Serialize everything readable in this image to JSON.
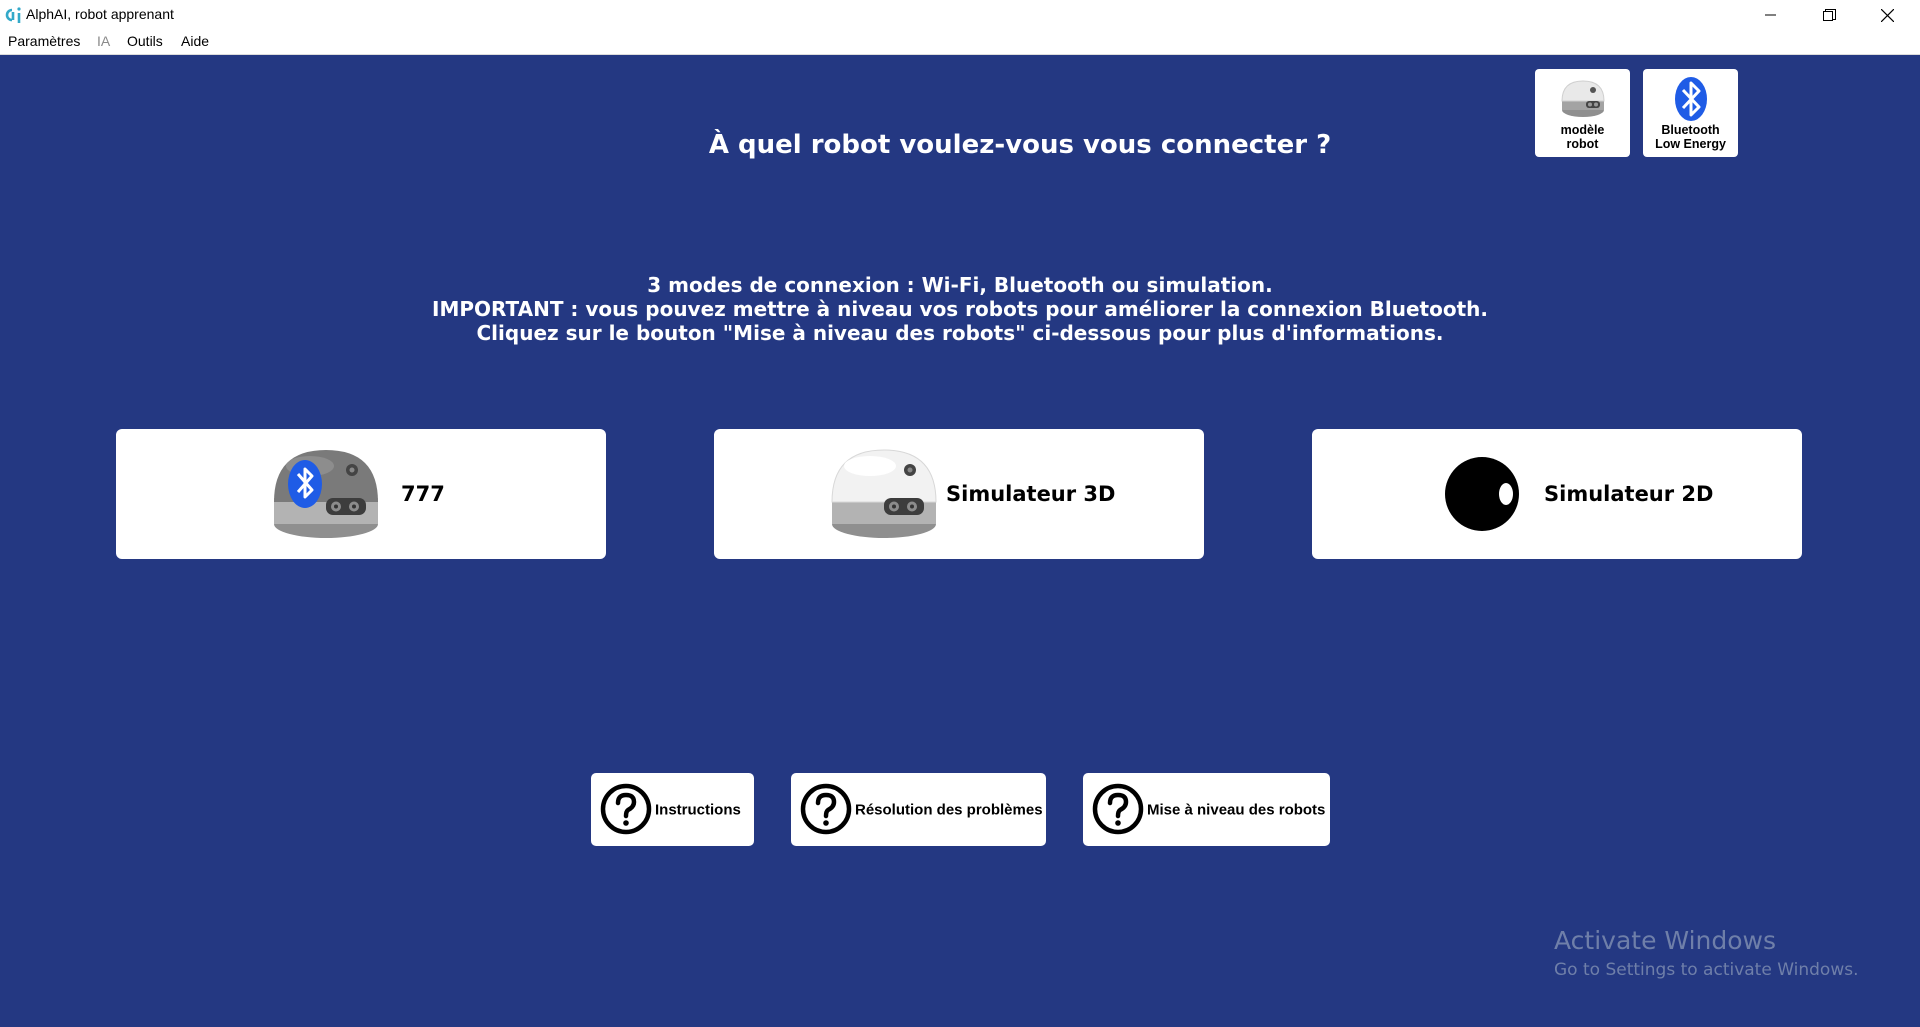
{
  "window": {
    "title": "AlphAI, robot apprenant",
    "logo_color": "#33a9c9"
  },
  "menu": {
    "items": [
      {
        "label": "Paramètres",
        "enabled": true
      },
      {
        "label": "IA",
        "enabled": false
      },
      {
        "label": "Outils",
        "enabled": true
      },
      {
        "label": "Aide",
        "enabled": true
      }
    ]
  },
  "top_buttons": {
    "robot_model_label": "modèle\nrobot",
    "bluetooth_label": "Bluetooth\nLow Energy"
  },
  "heading": "À quel robot voulez-vous vous connecter ?",
  "info_lines": [
    "3 modes de connexion : Wi-Fi, Bluetooth ou simulation.",
    "IMPORTANT : vous pouvez mettre à niveau vos robots pour améliorer la connexion Bluetooth.",
    "Cliquez sur le bouton \"Mise à niveau des robots\" ci-dessous pour plus d'informations."
  ],
  "robots": [
    {
      "name": "777",
      "icon": "bluetooth-robot-icon"
    },
    {
      "name": "Simulateur 3D",
      "icon": "robot-3d-icon"
    },
    {
      "name": "Simulateur 2D",
      "icon": "robot-2d-icon"
    }
  ],
  "help_buttons": [
    {
      "label": "Instructions",
      "icon": "question-icon"
    },
    {
      "label": "Résolution des problèmes",
      "icon": "question-icon"
    },
    {
      "label": "Mise à niveau des robots",
      "icon": "question-icon"
    }
  ],
  "watermark": {
    "title": "Activate Windows",
    "subtitle": "Go to Settings to activate Windows."
  },
  "colors": {
    "background": "#243882",
    "bluetooth_blue": "#1f5ce6"
  }
}
